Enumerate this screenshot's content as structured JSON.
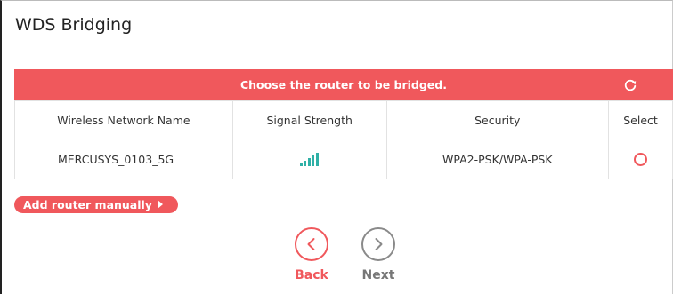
{
  "page": {
    "title": "WDS Bridging"
  },
  "header": {
    "text": "Choose the router to be bridged.",
    "refresh_icon": "refresh-icon"
  },
  "table": {
    "columns": [
      "Wireless Network Name",
      "Signal Strength",
      "Security",
      "Select"
    ],
    "rows": [
      {
        "ssid": "MERCUSYS_0103_5G",
        "signal_level": 5,
        "security": "WPA2-PSK/WPA-PSK",
        "selected": false
      }
    ]
  },
  "add_router": {
    "label": "Add router manually"
  },
  "nav": {
    "back_label": "Back",
    "next_label": "Next"
  },
  "colors": {
    "accent": "#f0585c",
    "signal": "#2fb0a6",
    "disabled": "#8a8a8a"
  }
}
